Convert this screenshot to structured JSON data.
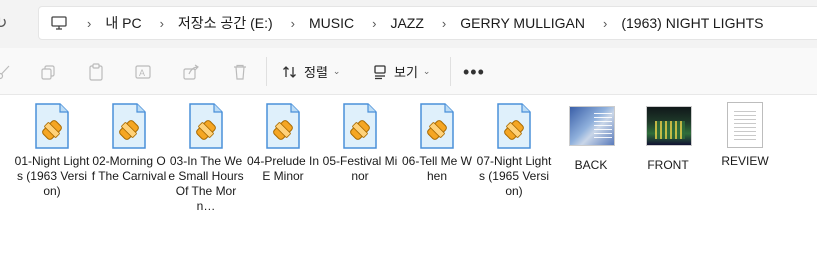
{
  "breadcrumb": {
    "segments": [
      "내 PC",
      "저장소 공간 (E:)",
      "MUSIC",
      "JAZZ",
      "GERRY MULLIGAN",
      "(1963) NIGHT LIGHTS"
    ]
  },
  "toolbar": {
    "sort_label": "정렬",
    "view_label": "보기",
    "more_label": "•••"
  },
  "files": [
    {
      "name": "01-Night Lights (1963 Version)",
      "type": "audio"
    },
    {
      "name": "02-Morning Of The Carnival",
      "type": "audio"
    },
    {
      "name": "03-In The Wee Small Hours Of The Morn…",
      "type": "audio"
    },
    {
      "name": "04-Prelude In E Minor",
      "type": "audio"
    },
    {
      "name": "05-Festival Minor",
      "type": "audio"
    },
    {
      "name": "06-Tell Me When",
      "type": "audio"
    },
    {
      "name": "07-Night Lights (1965 Version)",
      "type": "audio"
    },
    {
      "name": "BACK",
      "type": "image"
    },
    {
      "name": "FRONT",
      "type": "image"
    },
    {
      "name": "REVIEW",
      "type": "text"
    }
  ],
  "colors": {
    "audio_icon_blue": "#4a90d9",
    "audio_icon_orange": "#f5a623",
    "toolbar_bg": "#f9f9f9",
    "address_bg": "#f3f3f3"
  }
}
